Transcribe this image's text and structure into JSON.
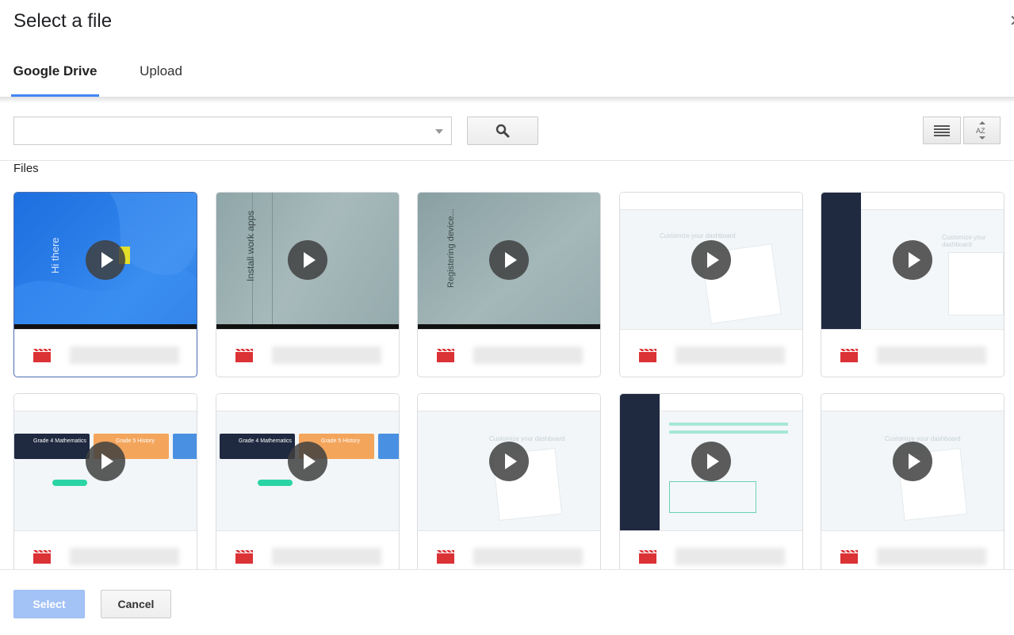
{
  "dialog": {
    "title": "Select a file"
  },
  "tabs": [
    {
      "label": "Google Drive",
      "active": true
    },
    {
      "label": "Upload",
      "active": false
    }
  ],
  "search": {
    "value": "",
    "placeholder": ""
  },
  "icons": {
    "search": "search-icon",
    "list_view": "list-view-icon",
    "sort": "sort-az-icon",
    "play": "play-icon",
    "file_type": "video-file-icon"
  },
  "section": {
    "label": "Files"
  },
  "thumb_text": {
    "hi_there": "Hi there",
    "install_work_apps": "Install work apps",
    "registering_device": "Registering device...",
    "customize_dashboard": "Customize your dashboard",
    "grade4_math": "Grade 4 Mathematics",
    "grade5_history": "Grade 5 History"
  },
  "colors": {
    "accent": "#4285f4",
    "select_button": "#a3c2f6",
    "file_icon": "#db3236"
  },
  "buttons": {
    "select": "Select",
    "cancel": "Cancel"
  }
}
